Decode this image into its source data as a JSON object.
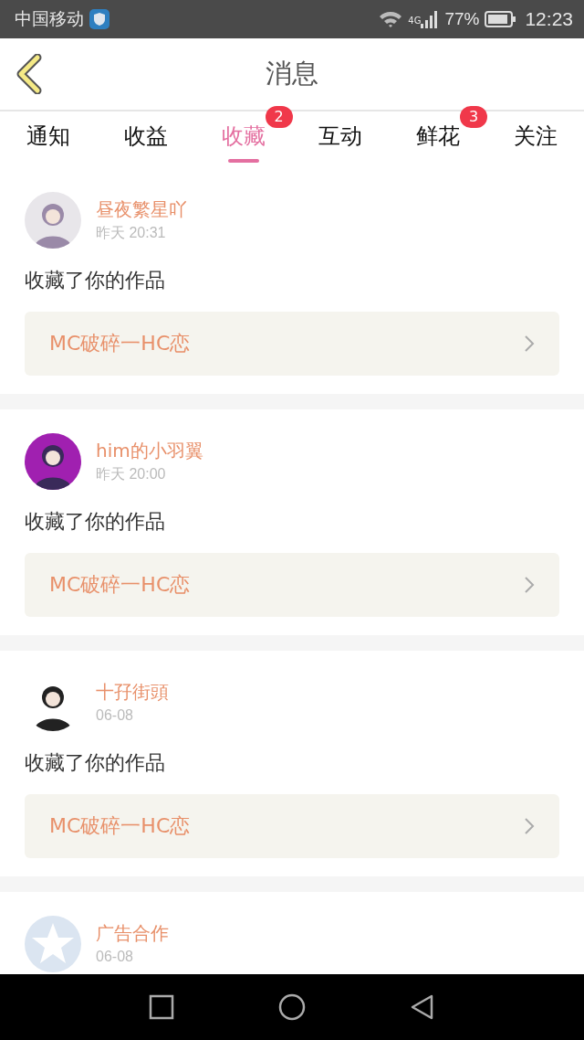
{
  "status_bar": {
    "carrier": "中国移动",
    "network": "4G",
    "battery": "77%",
    "time": "12:23"
  },
  "header": {
    "title": "消息"
  },
  "tabs": [
    {
      "label": "通知",
      "selected": false
    },
    {
      "label": "收益",
      "selected": false
    },
    {
      "label": "收藏",
      "selected": true,
      "badge": "2"
    },
    {
      "label": "互动",
      "selected": false
    },
    {
      "label": "鲜花",
      "selected": false,
      "badge": "3"
    },
    {
      "label": "关注",
      "selected": false
    }
  ],
  "messages": [
    {
      "name": "昼夜繁星吖",
      "time": "昨天 20:31",
      "kind": "picture",
      "action": "收藏了你的作品",
      "work": "MC破碎一HC恋"
    },
    {
      "name": "him的小羽翼",
      "time": "昨天 20:00",
      "kind": "picture",
      "action": "收藏了你的作品",
      "work": "MC破碎一HC恋"
    },
    {
      "name": "十孖街頭",
      "time": "06-08",
      "kind": "picture",
      "action": "收藏了你的作品",
      "work": "MC破碎一HC恋"
    },
    {
      "name": "广告合作",
      "time": "06-08",
      "kind": "icon"
    }
  ]
}
